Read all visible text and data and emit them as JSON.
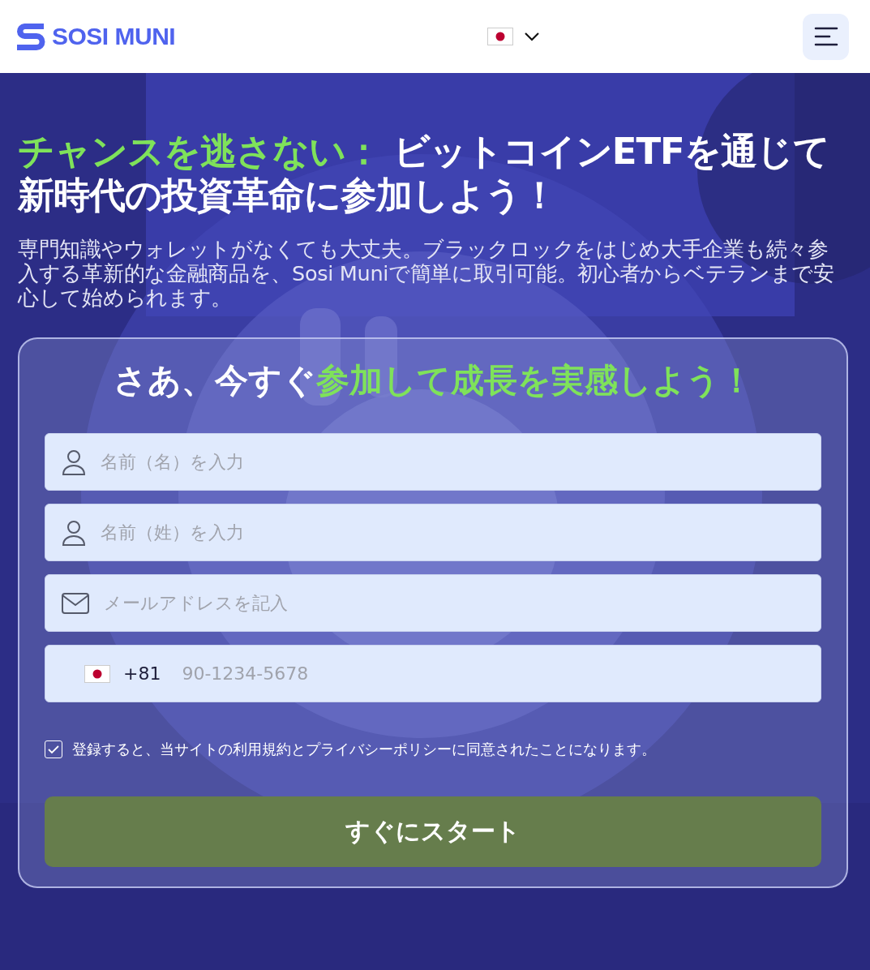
{
  "header": {
    "logo_text": "SOSI MUNI"
  },
  "hero": {
    "heading": {
      "highlight": "チャンスを逃さない：",
      "rest": " ビットコインETFを通じて新時代の投資革命に参加しよう！"
    },
    "description": "専門知識やウォレットがなくても大丈夫。ブラックロックをはじめ大手企業も続々参入する革新的な金融商品を、Sosi Muniで簡単に取引可能。初心者からベテランまで安心して始められます。"
  },
  "form": {
    "title": {
      "lead": "さあ、今すぐ",
      "highlight": "参加して成長を実感しよう！"
    },
    "fields": [
      {
        "kind": "person",
        "placeholder": "名前（名）を入力"
      },
      {
        "kind": "person",
        "placeholder": "名前（姓）を入力"
      },
      {
        "kind": "email",
        "placeholder": "メールアドレスを記入"
      },
      {
        "kind": "phone",
        "code": "+81",
        "placeholder": "90-1234-5678"
      }
    ],
    "consent": {
      "checked": true,
      "label": "登録すると、当サイトの利用規約とプライバシーポリシーに同意されたことになります。"
    },
    "submit": "すぐにスタート"
  }
}
